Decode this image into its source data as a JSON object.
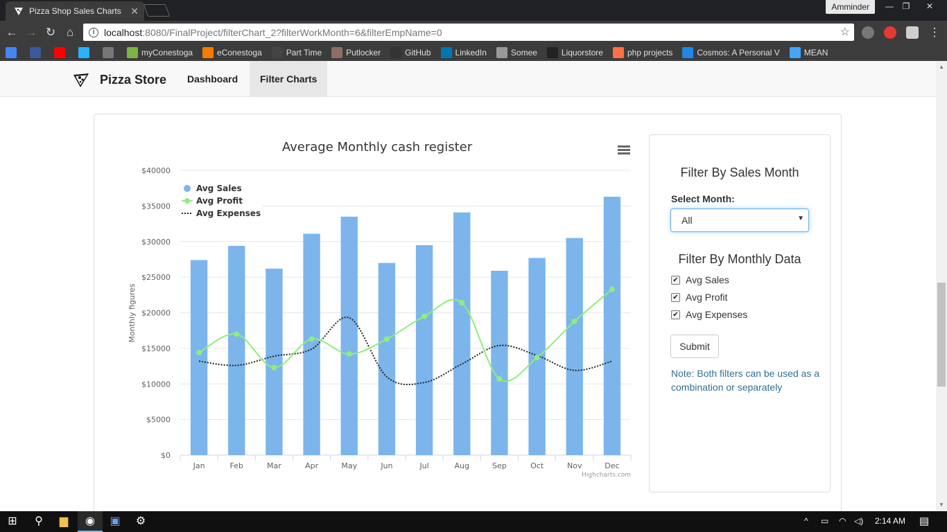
{
  "browser": {
    "tab_title": "Pizza Shop Sales Charts",
    "profile_name": "Amminder",
    "url_host": "localhost",
    "url_path": ":8080/FinalProject/filterChart_2?filterWorkMonth=6&filterEmpName=0",
    "bookmarks": [
      {
        "label": "",
        "icon": "google-icon",
        "color": "#4285f4"
      },
      {
        "label": "",
        "icon": "facebook-icon",
        "color": "#3b5998"
      },
      {
        "label": "",
        "icon": "youtube-icon",
        "color": "#ff0000"
      },
      {
        "label": "",
        "icon": "freelancer-icon",
        "color": "#29b2fe"
      },
      {
        "label": "",
        "icon": "sync-icon",
        "color": "#777777"
      },
      {
        "label": "myConestoga",
        "icon": "myconestoga-icon",
        "color": "#7cb342"
      },
      {
        "label": "eConestoga",
        "icon": "econestoga-icon",
        "color": "#f57c00"
      },
      {
        "label": "Part Time",
        "icon": "parttime-icon",
        "color": "#444444"
      },
      {
        "label": "Putlocker",
        "icon": "putlocker-icon",
        "color": "#8d6e63"
      },
      {
        "label": "GitHub",
        "icon": "github-icon",
        "color": "#333333"
      },
      {
        "label": "LinkedIn",
        "icon": "linkedin-icon",
        "color": "#0077b5"
      },
      {
        "label": "Somee",
        "icon": "document-icon",
        "color": "#999999"
      },
      {
        "label": "Liquorstore",
        "icon": "bottle-icon",
        "color": "#222222"
      },
      {
        "label": "php projects",
        "icon": "php-icon",
        "color": "#ff7043"
      },
      {
        "label": "Cosmos: A Personal V",
        "icon": "cosmos-icon",
        "color": "#1e88e5"
      },
      {
        "label": "MEAN",
        "icon": "mean-icon",
        "color": "#42a5f5"
      }
    ]
  },
  "nav": {
    "brand": "Pizza Store",
    "links": [
      "Dashboard",
      "Filter Charts"
    ]
  },
  "filters": {
    "month_heading": "Filter By Sales Month",
    "select_label": "Select Month:",
    "select_value": "All",
    "data_heading": "Filter By Monthly Data",
    "checkboxes": [
      {
        "label": "Avg Sales",
        "checked": true
      },
      {
        "label": "Avg Profit",
        "checked": true
      },
      {
        "label": "Avg Expenses",
        "checked": true
      }
    ],
    "submit_label": "Submit",
    "note": "Note: Both filters can be used as a combination or separately"
  },
  "chart_data": {
    "type": "bar",
    "title": "Average Monthly cash register",
    "ylabel": "Monthly figures",
    "credit": "Highcharts.com",
    "categories": [
      "Jan",
      "Feb",
      "Mar",
      "Apr",
      "May",
      "Jun",
      "Jul",
      "Aug",
      "Sep",
      "Oct",
      "Nov",
      "Dec"
    ],
    "yticks": [
      "$0",
      "$5000",
      "$10000",
      "$15000",
      "$20000",
      "$25000",
      "$30000",
      "$35000",
      "$40000"
    ],
    "ylim": [
      0,
      40000
    ],
    "legend_position": "top-left",
    "grid": true,
    "series": [
      {
        "name": "Avg Sales",
        "kind": "bar",
        "color": "#7cb5ec",
        "values": [
          27400,
          29400,
          26200,
          31100,
          33500,
          27000,
          29500,
          34100,
          25900,
          27700,
          30500,
          36300
        ]
      },
      {
        "name": "Avg Profit",
        "kind": "spline",
        "color": "#90ed7d",
        "values": [
          14400,
          17000,
          12300,
          16300,
          14200,
          16300,
          19500,
          21400,
          10700,
          13700,
          18800,
          23300
        ]
      },
      {
        "name": "Avg Expenses",
        "kind": "spline-dotted",
        "color": "#222222",
        "values": [
          13200,
          12600,
          13900,
          14900,
          19300,
          11000,
          10200,
          12800,
          15400,
          14000,
          11900,
          13200
        ]
      }
    ]
  },
  "taskbar": {
    "time": "2:14 AM"
  }
}
